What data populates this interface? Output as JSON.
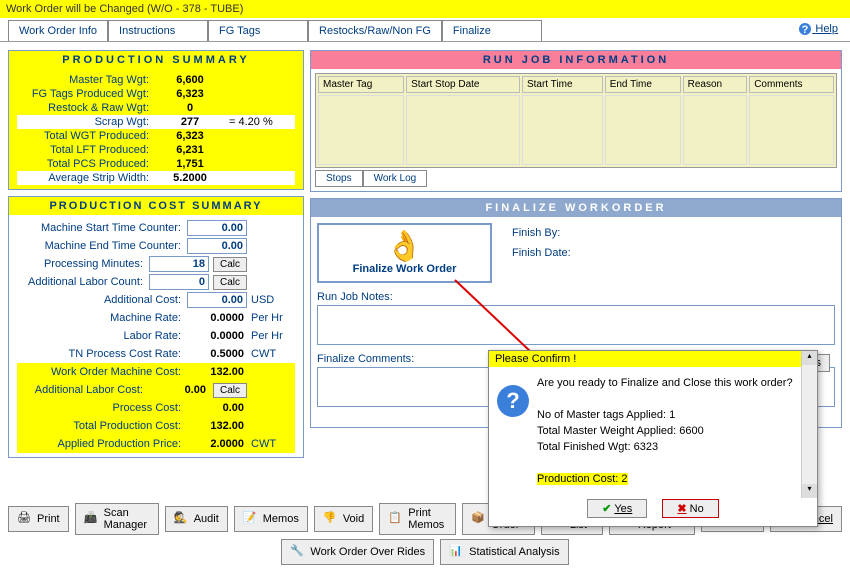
{
  "title": "Work Order will be Changed  (W/O - 378 - TUBE)",
  "help": "Help",
  "tabs": [
    "Work Order Info",
    "Instructions",
    "FG Tags",
    "Restocks/Raw/Non FG",
    "Finalize"
  ],
  "ps": {
    "head": "PRODUCTION   SUMMARY",
    "rows": [
      {
        "lbl": "Master Tag Wgt:",
        "val": "6,600"
      },
      {
        "lbl": "FG Tags Produced Wgt:",
        "val": "6,323"
      },
      {
        "lbl": "Restock & Raw Wgt:",
        "val": "0"
      },
      {
        "lbl": "Scrap Wgt:",
        "val": "277",
        "ext": "=    4.20  %",
        "white": true
      },
      {
        "lbl": "Total WGT Produced:",
        "val": "6,323"
      },
      {
        "lbl": "Total LFT Produced:",
        "val": "6,231"
      },
      {
        "lbl": "Total PCS Produced:",
        "val": "1,751"
      },
      {
        "lbl": "Average Strip Width:",
        "val": "5.2000",
        "white": true
      }
    ]
  },
  "pcs": {
    "head": "PRODUCTION  COST SUMMARY",
    "r1": {
      "lbl": "Machine Start Time Counter:",
      "val": "0.00"
    },
    "r2": {
      "lbl": "Machine End Time Counter:",
      "val": "0.00"
    },
    "r3": {
      "lbl": "Processing Minutes:",
      "val": "18",
      "btn": "Calc"
    },
    "r4": {
      "lbl": "Additional Labor Count:",
      "val": "0",
      "btn": "Calc"
    },
    "r5": {
      "lbl": "Additional Cost:",
      "val": "0.00",
      "unit": "USD"
    },
    "r6": {
      "lbl": "Machine Rate:",
      "val": "0.0000",
      "unit": "Per Hr"
    },
    "r7": {
      "lbl": "Labor Rate:",
      "val": "0.0000",
      "unit": "Per Hr"
    },
    "r8": {
      "lbl": "TN Process Cost Rate:",
      "val": "0.5000",
      "unit": "CWT"
    },
    "r9": {
      "lbl": "Work Order Machine Cost:",
      "val": "132.00"
    },
    "r10": {
      "lbl": "Additional Labor Cost:",
      "val": "0.00",
      "btn": "Calc"
    },
    "r11": {
      "lbl": "Process Cost:",
      "val": "0.00"
    },
    "r12": {
      "lbl": "Total Production Cost:",
      "val": "132.00"
    },
    "r13": {
      "lbl": "Applied Production Price:",
      "val": "2.0000",
      "unit": "CWT"
    }
  },
  "rji": {
    "head": "RUN  JOB  INFORMATION",
    "cols": [
      "Master Tag",
      "Start Stop Date",
      "Start Time",
      "End Time",
      "Reason",
      "Comments"
    ],
    "subtabs": [
      "Stops",
      "Work Log"
    ]
  },
  "fw": {
    "head": "FINALIZE   WORKORDER",
    "btn": "Finalize Work Order",
    "by": "Finish By:",
    "date": "Finish Date:",
    "notes": "Run Job Notes:",
    "comments": "Finalize Comments:",
    "memos": "Memos"
  },
  "confirm": {
    "title": "Please Confirm !",
    "q": "Are you ready to Finalize and Close this work order?",
    "l1": "No of Master tags Applied:   1",
    "l2": "Total Master Weight Applied:        6600",
    "l3": "Total Finished Wgt:              6323",
    "l4": "Production Cost:    2",
    "yes": "Yes",
    "no": "No"
  },
  "buttons": {
    "print": "Print",
    "scan": "Scan Manager",
    "audit": "Audit",
    "memos": "Memos",
    "void": "Void",
    "pmemos": "Print Memos",
    "pack": "Pack Order",
    "pick": "Pick List",
    "custom": "Custom Report",
    "save": "Save",
    "cancel": "Cancel",
    "over": "Work Order Over Rides",
    "stat": "Statistical Analysis"
  }
}
